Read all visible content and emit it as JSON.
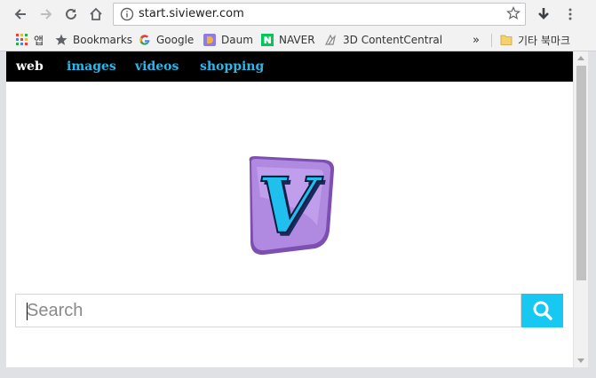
{
  "browser": {
    "url": "start.siviewer.com",
    "bookmarks": [
      {
        "label": "앱",
        "icon": "apps-grid-icon"
      },
      {
        "label": "Bookmarks",
        "icon": "star-icon"
      },
      {
        "label": "Google",
        "icon": "google-icon"
      },
      {
        "label": "Daum",
        "icon": "daum-icon"
      },
      {
        "label": "NAVER",
        "icon": "naver-icon"
      },
      {
        "label": "3D ContentCentral",
        "icon": "3d-contentcentral-icon"
      }
    ],
    "overflow_label": "»",
    "other_bookmarks": "기타 북마크"
  },
  "site": {
    "nav": [
      {
        "label": "web",
        "active": true
      },
      {
        "label": "images",
        "active": false
      },
      {
        "label": "videos",
        "active": false
      },
      {
        "label": "shopping",
        "active": false
      }
    ],
    "search": {
      "placeholder": "Search",
      "value": ""
    },
    "logo_letter": "V"
  },
  "colors": {
    "nav_background": "#000000",
    "nav_link": "#2ab8e8",
    "nav_active": "#ffffff",
    "search_button": "#16c8f2",
    "logo_purple": "#a87ad6",
    "logo_letter": "#1fc0ee"
  }
}
